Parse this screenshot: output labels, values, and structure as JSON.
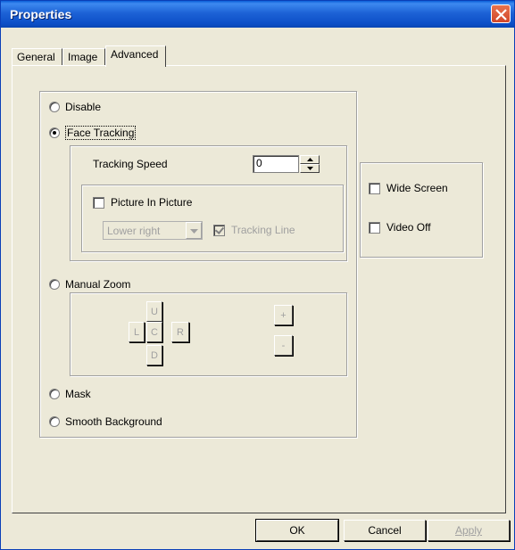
{
  "window": {
    "title": "Properties"
  },
  "tabs": [
    {
      "label": "General"
    },
    {
      "label": "Image"
    },
    {
      "label": "Advanced"
    }
  ],
  "modes": {
    "disable": "Disable",
    "face_tracking": "Face Tracking",
    "manual_zoom": "Manual Zoom",
    "mask": "Mask",
    "smooth_background": "Smooth Background",
    "selected": "face_tracking"
  },
  "face_tracking": {
    "tracking_speed_label": "Tracking Speed",
    "tracking_speed_value": "0",
    "pip_label": "Picture In Picture",
    "pip_checked": false,
    "pip_position": "Lower right",
    "tracking_line_label": "Tracking Line",
    "tracking_line_checked": true
  },
  "manual_zoom": {
    "up": "U",
    "left": "L",
    "center": "C",
    "right": "R",
    "down": "D",
    "zoom_in": "+",
    "zoom_out": "-"
  },
  "options": {
    "wide_screen": "Wide Screen",
    "video_off": "Video Off"
  },
  "buttons": {
    "ok": "OK",
    "cancel": "Cancel",
    "apply": "Apply"
  }
}
